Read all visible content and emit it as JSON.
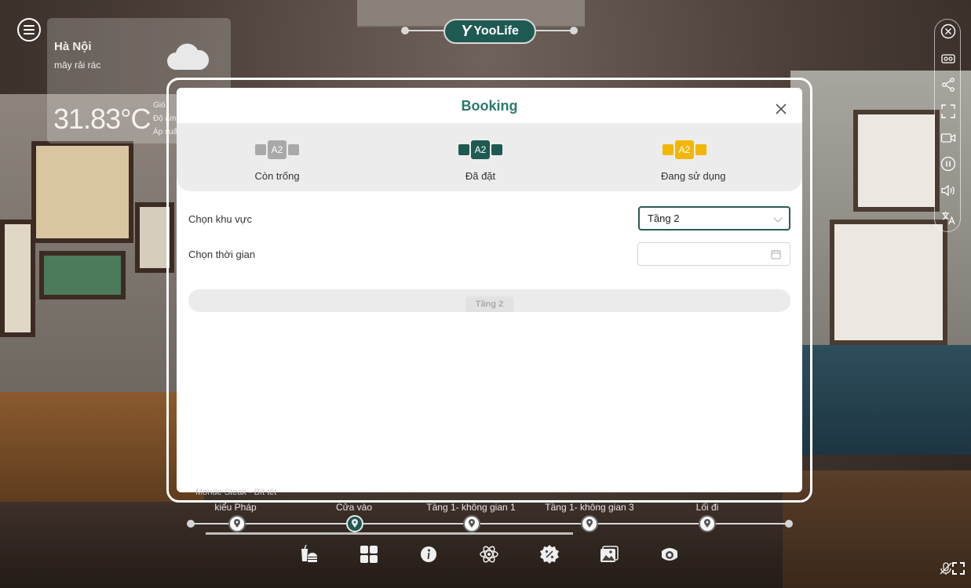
{
  "weather": {
    "city": "Hà Nội",
    "description": "mây rải rác",
    "temperature": "31.83°C",
    "detail_1": "Gió",
    "detail_2": "Độ ẩm",
    "detail_3": "Áp suất"
  },
  "logo": {
    "text": "YooLife"
  },
  "modal": {
    "title": "Booking",
    "legend": [
      {
        "seat_label": "A2",
        "label": "Còn trống",
        "color": "#a9a9a9"
      },
      {
        "seat_label": "A2",
        "label": "Đã đặt",
        "color": "#1f5a52"
      },
      {
        "seat_label": "A2",
        "label": "Đang sử dụng",
        "color": "#f2b705"
      }
    ],
    "area_label": "Chọn khu vực",
    "area_value": "Tầng 2",
    "time_label": "Chọn thời gian",
    "time_value": "",
    "floor_tab": "Tầng 2"
  },
  "tour": {
    "partial_label": "Monde Steak - Bít tết",
    "stops": [
      {
        "label": "kiểu Pháp",
        "active": false
      },
      {
        "label": "Cửa vào",
        "active": true
      },
      {
        "label": "Tầng 1- không gian 1",
        "active": false
      },
      {
        "label": "Tầng 1- không gian 3",
        "active": false
      },
      {
        "label": "Lối đi",
        "active": false
      }
    ]
  },
  "colors": {
    "brand": "#1f5a52",
    "title": "#2c7a6a",
    "reserved": "#1f5a52",
    "in_use": "#f2b705",
    "available": "#a9a9a9"
  }
}
